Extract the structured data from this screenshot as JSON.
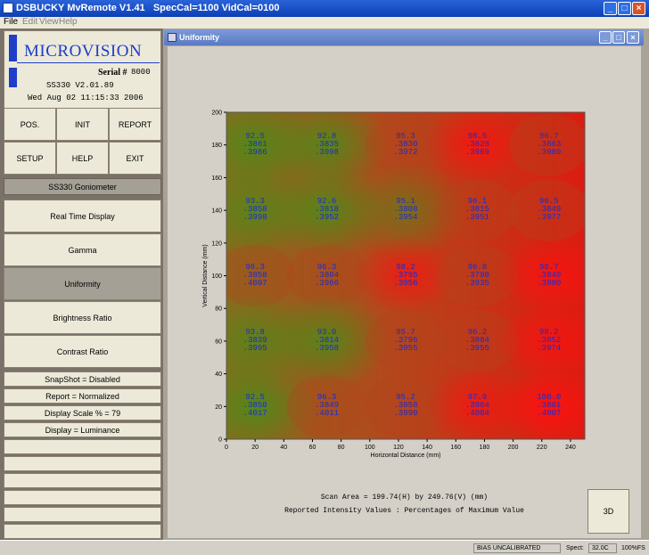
{
  "window": {
    "title": "DSBUCKY MvRemote V1.41   SpecCal=1100 VidCal=0100"
  },
  "menu": [
    "File",
    "Edit",
    "View",
    "Help"
  ],
  "logo": {
    "company": "MICROVISION",
    "serial_label": "Serial #",
    "serial_value": "8000",
    "version": "SS330 V2.01.89",
    "datetime": "Wed Aug 02 11:15:33 2006"
  },
  "buttons": [
    "POS.",
    "INIT",
    "REPORT",
    "SETUP",
    "HELP",
    "EXIT"
  ],
  "section_header": "SS330 Goniometer",
  "menu_items": [
    "Real Time Display",
    "Gamma",
    "Uniformity",
    "Brightness Ratio",
    "Contrast Ratio"
  ],
  "selected_item": "Uniformity",
  "status_rows": [
    "SnapShot = Disabled",
    "Report = Normalized",
    "Display Scale % = 79",
    "Display = Luminance"
  ],
  "child_window": {
    "title": "Uniformity"
  },
  "chart_data": {
    "type": "heatmap",
    "xlabel": "Horizontal Distance (mm)",
    "ylabel": "Vertical Distance (mm)",
    "xlim": [
      0,
      250
    ],
    "ylim": [
      0,
      200
    ],
    "xticks": [
      0,
      20,
      40,
      60,
      80,
      100,
      120,
      140,
      160,
      180,
      200,
      220,
      240
    ],
    "yticks": [
      0,
      20,
      40,
      60,
      80,
      100,
      120,
      140,
      160,
      180,
      200
    ],
    "x": [
      20,
      70,
      125,
      175,
      225
    ],
    "y": [
      180,
      140,
      100,
      60,
      20
    ],
    "rows": [
      [
        [
          "92.5",
          ".3861",
          ".3986"
        ],
        [
          "92.8",
          ".3835",
          ".3998"
        ],
        [
          "95.3",
          ".3830",
          ".3972"
        ],
        [
          "98.5",
          ".3828",
          ".3969"
        ],
        [
          "96.7",
          ".3863",
          ".3980"
        ]
      ],
      [
        [
          "93.3",
          ".3858",
          ".3998"
        ],
        [
          "92.6",
          ".3818",
          ".3952"
        ],
        [
          "95.1",
          ".3808",
          ".3954"
        ],
        [
          "96.1",
          ".3815",
          ".3951"
        ],
        [
          "96.5",
          ".3849",
          ".3977"
        ]
      ],
      [
        [
          "96.3",
          ".3858",
          ".4007"
        ],
        [
          "96.3",
          ".3804",
          ".3966"
        ],
        [
          "98.2",
          ".3795",
          ".3956"
        ],
        [
          "96.8",
          ".3790",
          ".3935"
        ],
        [
          "98.7",
          ".3840",
          ".3980"
        ]
      ],
      [
        [
          "93.8",
          ".3839",
          ".3995"
        ],
        [
          "93.0",
          ".3814",
          ".3958"
        ],
        [
          "95.7",
          ".3796",
          ".3955"
        ],
        [
          "96.2",
          ".3804",
          ".3955"
        ],
        [
          "98.2",
          ".3852",
          ".3974"
        ]
      ],
      [
        [
          "92.5",
          ".3850",
          ".4017"
        ],
        [
          "96.3",
          ".3849",
          ".4011"
        ],
        [
          "95.2",
          ".3858",
          ".3990"
        ],
        [
          "97.9",
          ".3964",
          ".4004"
        ],
        [
          "100.0",
          ".3861",
          ".4007"
        ]
      ]
    ],
    "colors": {
      "low": "#5a8c1c",
      "mid": "#b84a1c",
      "high": "#e01010"
    }
  },
  "caption": {
    "line1": "Scan Area = 199.74(H) by 249.76(V) (mm)",
    "line2": "Reported Intensity Values : Percentages of Maximum Value"
  },
  "button_3d": "3D",
  "statusbar": {
    "bias": "BIAS UNCALIBRATED",
    "spect_label": "Spect:",
    "spect_value": "32.0C",
    "extra": "100%FS"
  }
}
